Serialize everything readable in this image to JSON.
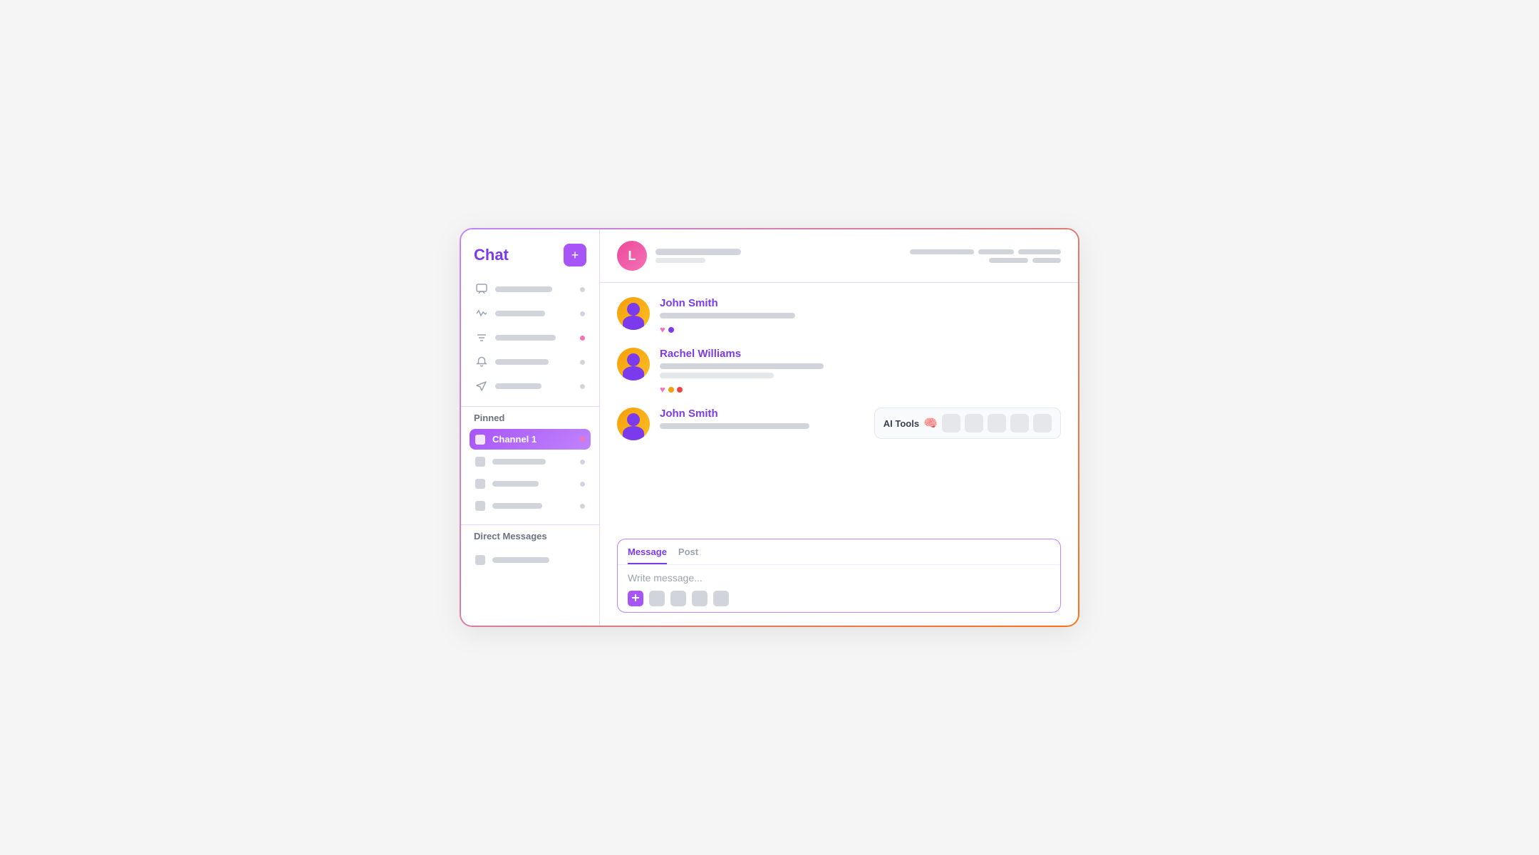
{
  "sidebar": {
    "title": "Chat",
    "add_button_label": "+",
    "nav_items": [
      {
        "icon": "chat-icon",
        "dot_color": "gray"
      },
      {
        "icon": "activity-icon",
        "dot_color": "gray"
      },
      {
        "icon": "filter-icon",
        "dot_color": "pink"
      },
      {
        "icon": "bell-icon",
        "dot_color": "gray"
      },
      {
        "icon": "send-icon",
        "dot_color": "gray"
      }
    ],
    "pinned_section_label": "Pinned",
    "pinned_items": [
      {
        "label": "Channel 1",
        "active": true
      },
      {
        "label": "",
        "active": false
      },
      {
        "label": "",
        "active": false
      },
      {
        "label": "",
        "active": false
      }
    ],
    "dm_section_label": "Direct Messages",
    "dm_items": [
      {
        "label": ""
      }
    ]
  },
  "header": {
    "avatar_letter": "L"
  },
  "messages": [
    {
      "sender": "John Smith",
      "reactions": [
        "heart",
        "dot-purple"
      ]
    },
    {
      "sender": "Rachel Williams",
      "reactions": [
        "heart",
        "dot-yellow",
        "dot-red"
      ]
    },
    {
      "sender": "John Smith",
      "has_ai_tools": true,
      "ai_tools_label": "AI Tools"
    }
  ],
  "compose": {
    "tab_message": "Message",
    "tab_post": "Post",
    "placeholder": "Write message..."
  }
}
